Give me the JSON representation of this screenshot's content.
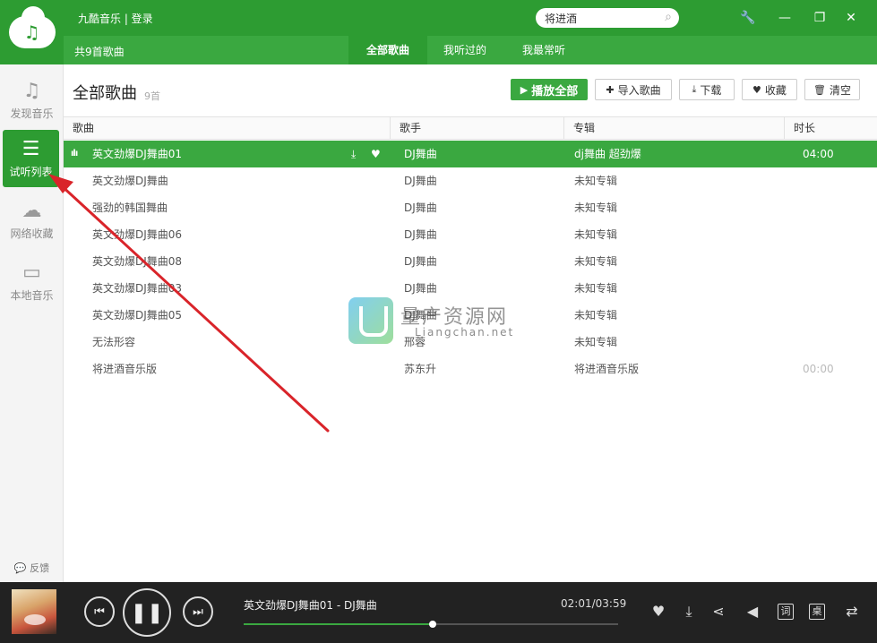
{
  "app": {
    "title": "九酷音乐 | 登录"
  },
  "search": {
    "value": "将进酒"
  },
  "window_controls": {
    "tools": "🔧",
    "minimize": "—",
    "restore": "❐",
    "close": "✕"
  },
  "subbar": {
    "count": "共9首歌曲",
    "tabs": [
      {
        "label": "全部歌曲",
        "active": true
      },
      {
        "label": "我听过的"
      },
      {
        "label": "我最常听"
      }
    ]
  },
  "sidebar": {
    "items": [
      {
        "icon": "music-note-icon",
        "glyph": "♫",
        "label": "发现音乐"
      },
      {
        "icon": "list-icon",
        "glyph": "☰",
        "label": "试听列表",
        "active": true
      },
      {
        "icon": "cloud-icon",
        "glyph": "☁",
        "label": "网络收藏"
      },
      {
        "icon": "monitor-icon",
        "glyph": "▭",
        "label": "本地音乐"
      }
    ],
    "feedback": "反馈"
  },
  "main": {
    "title": "全部歌曲",
    "subtitle": "9首",
    "buttons": {
      "play_all": "播放全部",
      "import": "导入歌曲",
      "download": "下载",
      "favorite": "收藏",
      "clear": "清空"
    }
  },
  "table": {
    "columns": [
      "歌曲",
      "歌手",
      "专辑",
      "时长"
    ],
    "rows": [
      {
        "song": "英文劲爆DJ舞曲01",
        "artist": "DJ舞曲",
        "album": "dj舞曲 超劲爆",
        "duration": "04:00",
        "playing": true
      },
      {
        "song": "英文劲爆DJ舞曲",
        "artist": "DJ舞曲",
        "album": "未知专辑",
        "duration": ""
      },
      {
        "song": "强劲的韩国舞曲",
        "artist": "DJ舞曲",
        "album": "未知专辑",
        "duration": ""
      },
      {
        "song": "英文劲爆DJ舞曲06",
        "artist": "DJ舞曲",
        "album": "未知专辑",
        "duration": ""
      },
      {
        "song": "英文劲爆DJ舞曲08",
        "artist": "DJ舞曲",
        "album": "未知专辑",
        "duration": ""
      },
      {
        "song": "英文劲爆DJ舞曲03",
        "artist": "DJ舞曲",
        "album": "未知专辑",
        "duration": ""
      },
      {
        "song": "英文劲爆DJ舞曲05",
        "artist": "DJ舞曲",
        "album": "未知专辑",
        "duration": ""
      },
      {
        "song": "无法形容",
        "artist": "邢蓉",
        "album": "未知专辑",
        "duration": ""
      },
      {
        "song": "将进酒音乐版",
        "artist": "苏东升",
        "album": "将进酒音乐版",
        "duration": "00:00"
      }
    ]
  },
  "watermark": {
    "title": "量产资源网",
    "url": "Liangchan.net"
  },
  "player": {
    "now_playing": "英文劲爆DJ舞曲01 - DJ舞曲",
    "time": "02:01/03:59",
    "progress": 0.505,
    "lyrics_label": "词",
    "desktop_label": "桌"
  },
  "colors": {
    "accent": "#2d9c32",
    "accent_light": "#3aa840",
    "arrow": "#d9242a"
  }
}
